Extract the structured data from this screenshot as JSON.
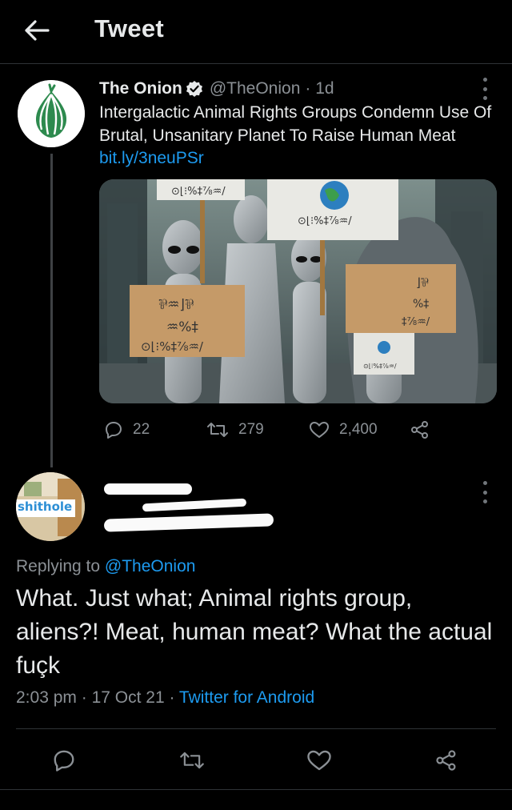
{
  "header": {
    "title": "Tweet"
  },
  "tweet": {
    "author_name": "The Onion",
    "author_handle": "@TheOnion",
    "age": "· 1d",
    "text": "Intergalactic Animal Rights Groups Condemn Use Of Brutal, Unsanitary Planet To Raise Human Meat",
    "link": "bit.ly/3neuPSr",
    "stats": {
      "replies": "22",
      "retweets": "279",
      "likes": "2,400"
    }
  },
  "reply": {
    "avatar_label": "shithole",
    "replying_prefix": "Replying to",
    "replying_mention": "@TheOnion",
    "text": "What. Just what; Animal rights group, aliens?! Meat, human meat? What the actual fuçk",
    "time": "2:03 pm",
    "date": "17 Oct 21",
    "source": "Twitter for Android"
  },
  "colors": {
    "accent": "#1d9bf0",
    "background": "#000000",
    "muted": "#8b9095",
    "onion_green": "#2d8a4e"
  }
}
